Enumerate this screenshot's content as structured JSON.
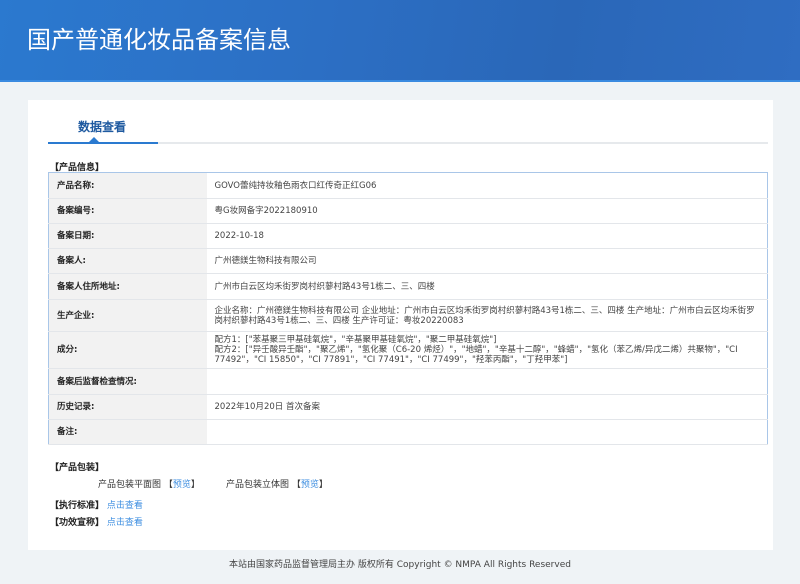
{
  "header": {
    "title": "国产普通化妆品备案信息"
  },
  "tab": {
    "label": "数据查看"
  },
  "product_info": {
    "title": "【产品信息】",
    "rows": [
      {
        "label": "产品名称:",
        "value": "GOVO蕾纯持妆釉色雨衣口红传奇正红G06"
      },
      {
        "label": "备案编号:",
        "value": "粤G妆网备字2022180910"
      },
      {
        "label": "备案日期:",
        "value": "2022-10-18"
      },
      {
        "label": "备案人:",
        "value": "广州德鎂生物科技有限公司"
      },
      {
        "label": "备案人住所地址:",
        "value": "广州市白云区均禾街罗岗村织蓼村路43号1栋二、三、四楼"
      },
      {
        "label": "生产企业:",
        "value": "企业名称：广州德鎂生物科技有限公司 企业地址：广州市白云区均禾街罗岗村织蓼村路43号1栋二、三、四楼 生产地址：广州市白云区均禾街罗岗村织蓼村路43号1栋二、三、四楼 生产许可证：粤妆20220083"
      },
      {
        "label": "成分:",
        "value": "配方1：[\"苯基聚三甲基硅氧烷\"，\"辛基聚甲基硅氧烷\"，\"聚二甲基硅氧烷\"]\n配方2：[\"异壬酸异壬酯\"，\"聚乙烯\"，\"氢化聚（C6-20 烯烃）\"，\"地蜡\"，\"辛基十二醇\"，\"蜂蜡\"，\"氢化（苯乙烯/异戊二烯）共聚物\"，\"CI 77492\"，\"CI 15850\"，\"CI 77891\"，\"CI 77491\"，\"CI 77499\"，\"羟苯丙酯\"，\"丁羟甲苯\"]"
      },
      {
        "label": "备案后监督检查情况:",
        "value": ""
      },
      {
        "label": "历史记录:",
        "value": "2022年10月20日 首次备案"
      },
      {
        "label": "备注:",
        "value": ""
      }
    ]
  },
  "packaging": {
    "title": "【产品包装】",
    "flat_label": "产品包装平面图",
    "solid_label": "产品包装立体图",
    "preview": "预览",
    "open_bracket": "【",
    "close_bracket": "】"
  },
  "standard": {
    "label": "【执行标准】",
    "link": "点击查看"
  },
  "efficacy": {
    "label": "【功效宣称】",
    "link": "点击查看"
  },
  "footer": {
    "text": "本站由国家药品监督管理局主办 版权所有 Copyright © NMPA All Rights Reserved"
  },
  "colors": {
    "header": "#2c6fc4",
    "accent": "#2a7ad0",
    "link": "#3d8ee0"
  }
}
